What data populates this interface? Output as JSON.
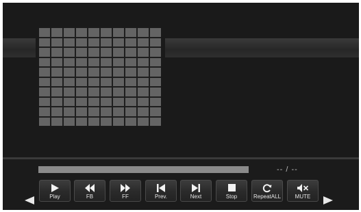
{
  "player": {
    "time_display": "-- / --",
    "progress": 1.0,
    "buttons": {
      "play": "Play",
      "fb": "FB",
      "ff": "FF",
      "prev": "Prev.",
      "next": "Next",
      "stop": "Stop",
      "repeat": "RepeatALL",
      "mute": "MUTE"
    }
  },
  "colors": {
    "background": "#1c1c1c",
    "button_text": "#e6e6e6",
    "icon": "#f2f2f2",
    "progress_bar": "#808080"
  },
  "icons": [
    "play-icon",
    "fast-backward-icon",
    "fast-forward-icon",
    "previous-icon",
    "next-icon",
    "stop-icon",
    "repeat-icon",
    "mute-icon",
    "arrow-left-icon",
    "arrow-right-icon"
  ]
}
